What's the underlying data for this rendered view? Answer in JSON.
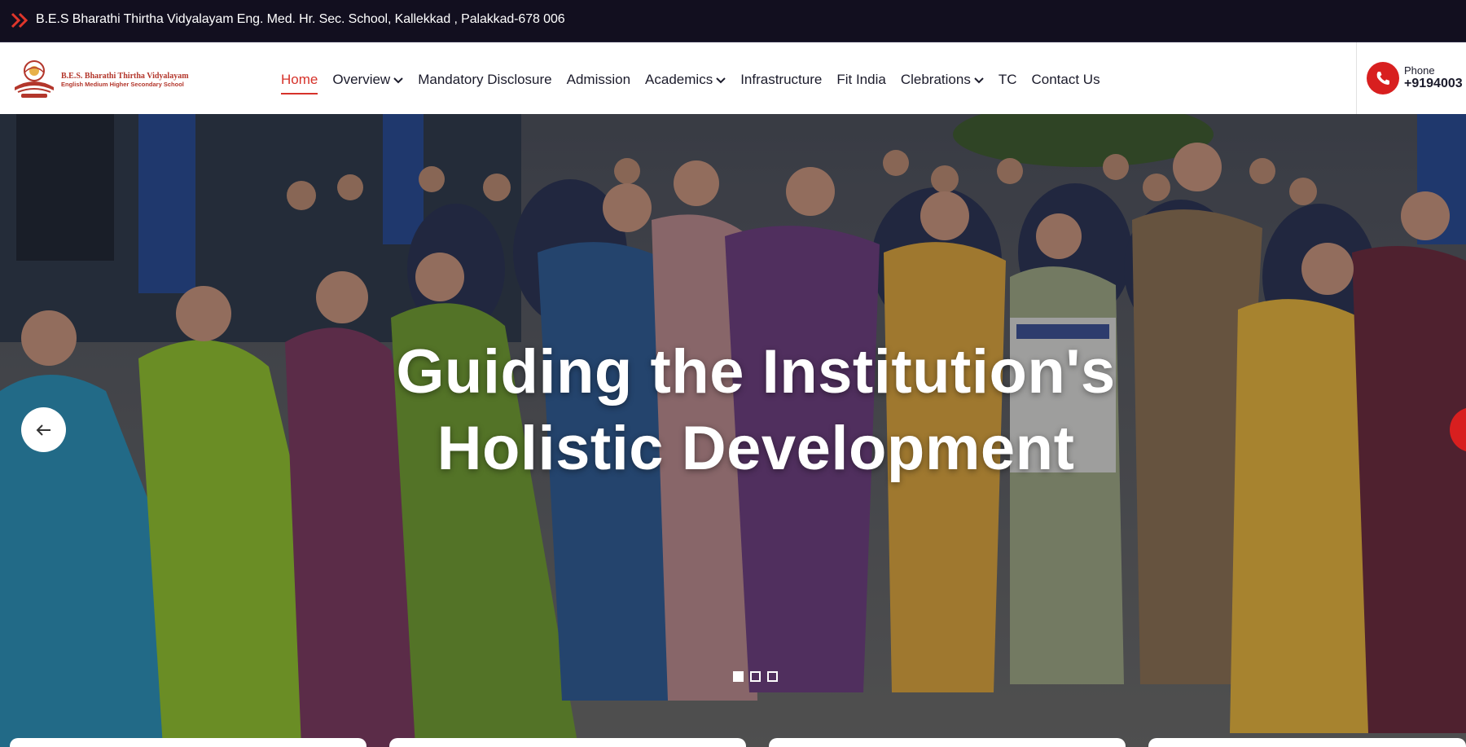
{
  "topbar": {
    "address": "B.E.S Bharathi Thirtha Vidyalayam Eng. Med. Hr. Sec. School, Kallekkad , Palakkad-678 006",
    "icon": "double-chevron-right-icon",
    "bg_color": "#120f1f",
    "accent_color": "#e0362b"
  },
  "brand": {
    "line1": "B.E.S. Bharathi Thirtha Vidyalayam",
    "line2": "English Medium Higher Secondary School",
    "color": "#b3362b"
  },
  "nav": {
    "items": [
      {
        "label": "Home",
        "active": true,
        "has_dropdown": false
      },
      {
        "label": "Overview",
        "active": false,
        "has_dropdown": true
      },
      {
        "label": "Mandatory Disclosure",
        "active": false,
        "has_dropdown": false
      },
      {
        "label": "Admission",
        "active": false,
        "has_dropdown": false
      },
      {
        "label": "Academics",
        "active": false,
        "has_dropdown": true
      },
      {
        "label": "Infrastructure",
        "active": false,
        "has_dropdown": false
      },
      {
        "label": "Fit India",
        "active": false,
        "has_dropdown": false
      },
      {
        "label": "Clebrations",
        "active": false,
        "has_dropdown": true
      },
      {
        "label": "TC",
        "active": false,
        "has_dropdown": false
      },
      {
        "label": "Contact Us",
        "active": false,
        "has_dropdown": false
      }
    ],
    "active_color": "#d6322a"
  },
  "contact": {
    "label": "Phone",
    "number": "+9194003",
    "icon": "phone-icon",
    "icon_bg": "#d81f1f"
  },
  "hero": {
    "title_line1": "Guiding the Institution's",
    "title_line2": "Holistic Development",
    "prev_icon": "arrow-left-icon",
    "next_icon": "arrow-right-icon",
    "slides": 3,
    "active_slide": 1
  }
}
